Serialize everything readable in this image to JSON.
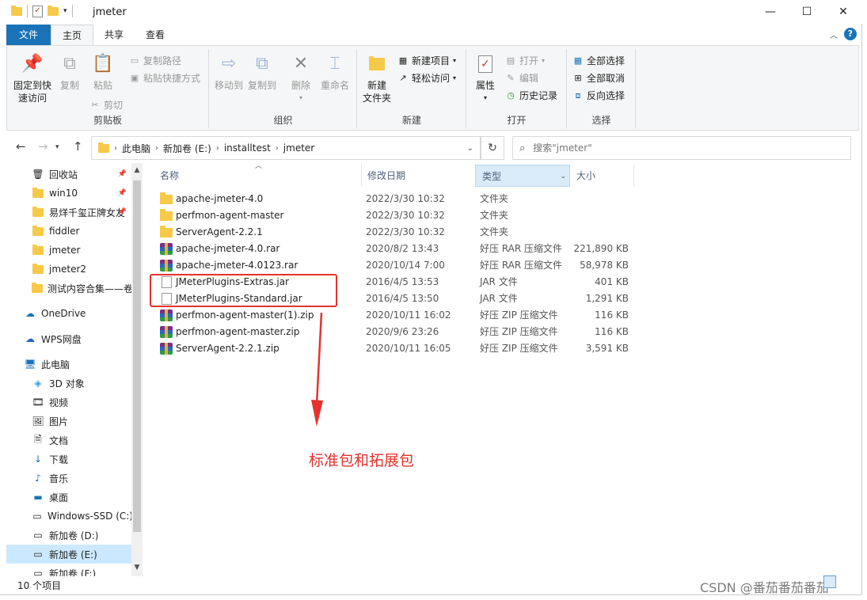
{
  "window": {
    "title": "jmeter",
    "minimize": "—",
    "maximize": "☐",
    "close": "✕"
  },
  "tabs": [
    {
      "label": "文件"
    },
    {
      "label": "主页"
    },
    {
      "label": "共享"
    },
    {
      "label": "查看"
    }
  ],
  "ribbon": {
    "clipboard": {
      "label": "剪贴板",
      "pin": "固定到快\n速访问",
      "pin_l1": "固定到快",
      "pin_l2": "速访问",
      "copy": "复制",
      "paste": "粘贴",
      "copy_path": "复制路径",
      "paste_shortcut": "粘贴快捷方式",
      "cut": "剪切"
    },
    "organize": {
      "label": "组织",
      "move_to": "移动到",
      "copy_to": "复制到",
      "delete": "删除",
      "rename": "重命名"
    },
    "new": {
      "label": "新建",
      "new_folder_l1": "新建",
      "new_folder_l2": "文件夹",
      "new_item": "新建项目",
      "easy_access": "轻松访问"
    },
    "open": {
      "label": "打开",
      "properties": "属性",
      "open": "打开",
      "edit": "编辑",
      "history": "历史记录"
    },
    "select": {
      "label": "选择",
      "select_all": "全部选择",
      "select_none": "全部取消",
      "invert": "反向选择"
    }
  },
  "address": {
    "crumbs": [
      "此电脑",
      "新加卷 (E:)",
      "installtest",
      "jmeter"
    ]
  },
  "search": {
    "placeholder": "搜索\"jmeter\""
  },
  "nav": [
    {
      "label": "回收站",
      "icon": "recycle-bin-icon",
      "pinned": true
    },
    {
      "label": "win10",
      "icon": "folder-icon",
      "pinned": true
    },
    {
      "label": "易烊千玺正牌女友",
      "icon": "folder-icon",
      "pinned": true
    },
    {
      "label": "fiddler",
      "icon": "folder-icon"
    },
    {
      "label": "jmeter",
      "icon": "folder-icon"
    },
    {
      "label": "jmeter2",
      "icon": "folder-icon"
    },
    {
      "label": "测试内容合集——卷",
      "icon": "folder-icon"
    },
    {
      "label": "OneDrive",
      "icon": "cloud-icon"
    },
    {
      "label": "WPS网盘",
      "icon": "cloud-icon"
    },
    {
      "label": "此电脑",
      "icon": "computer-icon"
    },
    {
      "label": "3D 对象",
      "icon": "cube-icon"
    },
    {
      "label": "视频",
      "icon": "video-icon"
    },
    {
      "label": "图片",
      "icon": "picture-icon"
    },
    {
      "label": "文档",
      "icon": "document-icon"
    },
    {
      "label": "下载",
      "icon": "download-icon"
    },
    {
      "label": "音乐",
      "icon": "music-icon"
    },
    {
      "label": "桌面",
      "icon": "desktop-icon"
    },
    {
      "label": "Windows-SSD (C:)",
      "icon": "drive-icon"
    },
    {
      "label": "新加卷 (D:)",
      "icon": "drive-icon"
    },
    {
      "label": "新加卷 (E:)",
      "icon": "drive-icon",
      "selected": true
    },
    {
      "label": "新加卷 (F:)",
      "icon": "drive-icon"
    }
  ],
  "columns": {
    "name": "名称",
    "date": "修改日期",
    "type": "类型",
    "size": "大小"
  },
  "files": [
    {
      "name": "apache-jmeter-4.0",
      "date": "2022/3/30 10:32",
      "type": "文件夹",
      "size": "",
      "icon": "folder"
    },
    {
      "name": "perfmon-agent-master",
      "date": "2022/3/30 10:32",
      "type": "文件夹",
      "size": "",
      "icon": "folder"
    },
    {
      "name": "ServerAgent-2.2.1",
      "date": "2022/3/30 10:32",
      "type": "文件夹",
      "size": "",
      "icon": "folder"
    },
    {
      "name": "apache-jmeter-4.0.rar",
      "date": "2020/8/2 13:43",
      "type": "好压 RAR 压缩文件",
      "size": "221,890 KB",
      "icon": "archive"
    },
    {
      "name": "apache-jmeter-4.0123.rar",
      "date": "2020/10/14 7:00",
      "type": "好压 RAR 压缩文件",
      "size": "58,978 KB",
      "icon": "archive"
    },
    {
      "name": "JMeterPlugins-Extras.jar",
      "date": "2016/4/5 13:53",
      "type": "JAR 文件",
      "size": "401 KB",
      "icon": "doc"
    },
    {
      "name": "JMeterPlugins-Standard.jar",
      "date": "2016/4/5 13:50",
      "type": "JAR 文件",
      "size": "1,291 KB",
      "icon": "doc"
    },
    {
      "name": "perfmon-agent-master(1).zip",
      "date": "2020/10/11 16:02",
      "type": "好压 ZIP 压缩文件",
      "size": "116 KB",
      "icon": "archive"
    },
    {
      "name": "perfmon-agent-master.zip",
      "date": "2020/9/6 23:26",
      "type": "好压 ZIP 压缩文件",
      "size": "116 KB",
      "icon": "archive"
    },
    {
      "name": "ServerAgent-2.2.1.zip",
      "date": "2020/10/11 16:05",
      "type": "好压 ZIP 压缩文件",
      "size": "3,591 KB",
      "icon": "archive"
    }
  ],
  "annotation": "标准包和拓展包",
  "status": "10 个项目",
  "watermark": "CSDN @番茄番茄番茄",
  "colors": {
    "accent": "#1a73b8",
    "annotation_red": "#e5322d",
    "selection": "#cce8ff"
  }
}
